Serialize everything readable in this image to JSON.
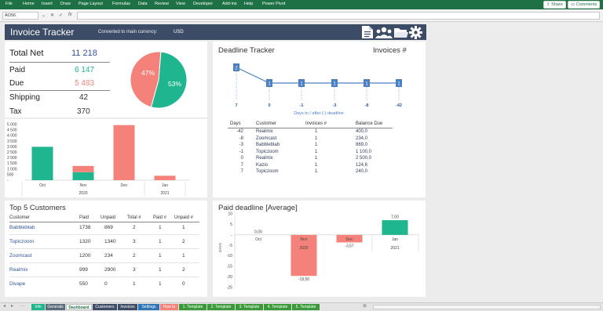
{
  "ribbon": {
    "menu": [
      "File",
      "Home",
      "Insert",
      "Draw",
      "Page Layout",
      "Formulas",
      "Data",
      "Review",
      "View",
      "Developer",
      "Add-ins",
      "Help",
      "Power Pivot"
    ],
    "share_label": "Share",
    "comments_label": "Comments"
  },
  "formula_bar": {
    "name_box": "AO56",
    "fx": "fx"
  },
  "header": {
    "title": "Invoice Tracker",
    "currency_label": "Converted to main currency:",
    "currency_value": "USD"
  },
  "kpi": {
    "total_net_label": "Total Net",
    "total_net": "11 218",
    "paid_label": "Paid",
    "paid": "6 147",
    "due_label": "Due",
    "due": "5 483",
    "shipping_label": "Shipping",
    "shipping": "42",
    "tax_label": "Tax",
    "tax": "370",
    "pie": {
      "due_pct_label": "47%",
      "paid_pct_label": "53%",
      "due_fraction": 0.47,
      "paid_fraction": 0.53,
      "paid_color": "#1fb58f",
      "due_color": "#f4827b"
    }
  },
  "monthly_chart": {
    "y_ticks": [
      "5 000",
      "4 500",
      "4 000",
      "3 500",
      "3 000",
      "2 500",
      "2 000",
      "1 500",
      "1 000",
      "500",
      "-"
    ],
    "months": [
      "Oct",
      "Nov",
      "Dec",
      "Jan"
    ],
    "years": [
      "2020",
      "2021"
    ]
  },
  "deadline_tracker": {
    "title": "Deadline Tracker",
    "invoices_label": "Invoices #",
    "x_label": "Days to / after (-) deadline",
    "days": [
      "7",
      "0",
      "-1",
      "-3",
      "-8",
      "-42"
    ],
    "counts": [
      "2",
      "1",
      "1",
      "1",
      "1",
      "1"
    ],
    "table_headers": [
      "Days",
      "Customer",
      "Invoices #",
      "Balance Due"
    ],
    "rows": [
      [
        "-42",
        "Realmix",
        "1",
        "400,0"
      ],
      [
        "-8",
        "Zoomcast",
        "1",
        "234,0"
      ],
      [
        "-3",
        "Babbleblab",
        "1",
        "869,0"
      ],
      [
        "-1",
        "Topiczoom",
        "1",
        "1 100,0"
      ],
      [
        "0",
        "Realmix",
        "1",
        "2 500,0"
      ],
      [
        "7",
        "Kazio",
        "1",
        "124,6"
      ],
      [
        "7",
        "Topiczoom",
        "1",
        "240,0"
      ]
    ]
  },
  "top_customers": {
    "title": "Top 5 Customers",
    "headers": [
      "Customer",
      "Paid",
      "Unpaid",
      "Total #",
      "Paid #",
      "Unpaid #"
    ],
    "rows": [
      [
        "Babbleblab",
        "1738",
        "869",
        "2",
        "1",
        "1"
      ],
      [
        "Topiczoom",
        "1320",
        "1340",
        "3",
        "1",
        "2"
      ],
      [
        "Zoomcast",
        "1200",
        "234",
        "2",
        "1",
        "1"
      ],
      [
        "Realmix",
        "999",
        "2900",
        "3",
        "1",
        "2"
      ],
      [
        "Divape",
        "550",
        "0",
        "1",
        "1",
        "0"
      ]
    ]
  },
  "paid_deadline": {
    "title": "Paid deadline [Average]",
    "y_label": "DAYS",
    "y_ticks": [
      "10",
      "5",
      "-",
      "-5",
      "-10",
      "-15",
      "-20",
      "-25"
    ],
    "months": [
      "Oct",
      "Nov",
      "Dec",
      "Jan"
    ],
    "years": [
      "2020",
      "2021"
    ],
    "value_labels": [
      "0,00",
      "-19,50",
      "-3,57",
      "7,00"
    ]
  },
  "chart_data": [
    {
      "type": "bar",
      "categories": [
        "Oct 2020",
        "Nov 2020",
        "Dec 2020",
        "Jan 2021"
      ],
      "series": [
        {
          "values": [
            3000,
            720,
            0,
            0
          ]
        },
        {
          "values": [
            0,
            560,
            4950,
            400
          ]
        }
      ],
      "ylim": [
        0,
        5000
      ]
    },
    {
      "type": "line",
      "x": [
        "7",
        "0",
        "-1",
        "-3",
        "-8",
        "-42"
      ],
      "values": [
        2,
        1,
        1,
        1,
        1,
        1
      ],
      "xlabel": "Days to / after (-) deadline"
    },
    {
      "type": "bar",
      "title": "Paid deadline [Average]",
      "categories": [
        "Oct 2020",
        "Nov 2020",
        "Dec 2020",
        "Jan 2021"
      ],
      "values": [
        0.0,
        -19.5,
        -3.57,
        7.0
      ],
      "ylabel": "DAYS",
      "ylim": [
        -25,
        10
      ]
    }
  ],
  "sheet_tabs": [
    {
      "label": "Info",
      "color": "#1fb58f"
    },
    {
      "label": "Generals",
      "color": "#5c6b7a"
    },
    {
      "label": "Dashboard",
      "color": "#ffffff"
    },
    {
      "label": "Customers",
      "color": "#3d4c66"
    },
    {
      "label": "Invoices",
      "color": "#3d4c66"
    },
    {
      "label": "Settings",
      "color": "#2e75b6"
    },
    {
      "label": "How to",
      "color": "#f4827b"
    },
    {
      "label": "1. Template",
      "color": "#3a9a3a"
    },
    {
      "label": "2. Template",
      "color": "#3a9a3a"
    },
    {
      "label": "3. Template",
      "color": "#3a9a3a"
    },
    {
      "label": "4. Template",
      "color": "#3a9a3a"
    },
    {
      "label": "5. Template",
      "color": "#3a9a3a"
    }
  ],
  "colors": {
    "green": "#1fb58f",
    "salmon": "#f4827b",
    "navy": "#3d4c66",
    "blue": "#4a7fc1"
  }
}
